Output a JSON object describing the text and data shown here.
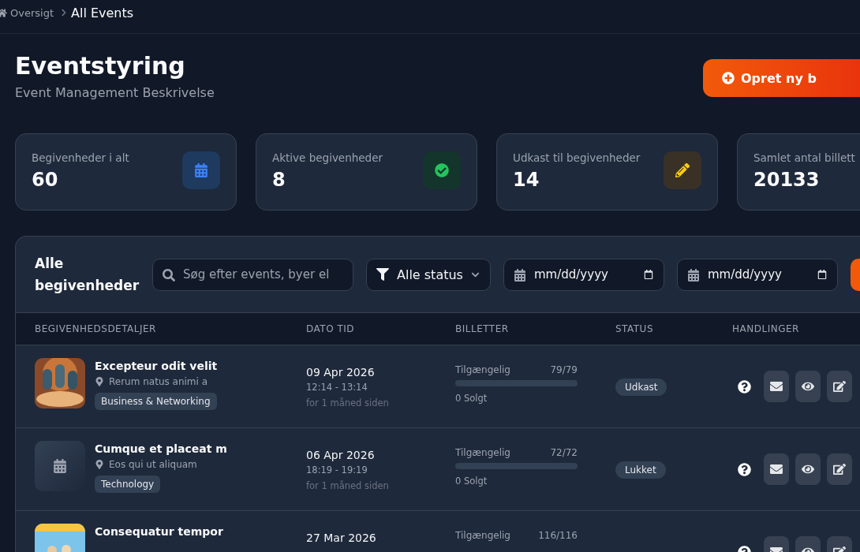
{
  "breadcrumb": [
    {
      "label": "Oversigt",
      "kind": "home"
    },
    {
      "label": "All Events",
      "kind": "current"
    }
  ],
  "header": {
    "title": "Eventstyring",
    "subtitle": "Event Management Beskrivelse",
    "create_button": "Opret ny b"
  },
  "stats": [
    {
      "label": "Begivenheder i alt",
      "value": "60",
      "kind": "calendar"
    },
    {
      "label": "Aktive begivenheder",
      "value": "8",
      "kind": "active"
    },
    {
      "label": "Udkast til begivenheder",
      "value": "14",
      "kind": "draft"
    },
    {
      "label": "Samlet antal billett",
      "value": "20133",
      "kind": "tickets"
    }
  ],
  "panel": {
    "title": "Alle begivenheder",
    "search": {
      "placeholder": "Søg efter events, byer el"
    },
    "status_filter": "Alle status",
    "date_from": {
      "placeholder": "mm/dd/yyyy"
    },
    "date_to": {
      "placeholder": "mm/dd/yyyy"
    }
  },
  "table": {
    "columns": [
      "BEGIVENHEDSDETALJER",
      "DATO TID",
      "BILLETTER",
      "STATUS",
      "HANDLINGER"
    ],
    "rows": [
      {
        "kind": "picture",
        "title": "Excepteur odit velit",
        "location": "Rerum natus animi a",
        "category": "Business & Networking",
        "date": "09 Apr 2026",
        "time": "12:14 - 13:14",
        "relative": "for 1 måned siden",
        "tickets_label": "Tilgængelig",
        "tickets": "79/79",
        "level": 0,
        "sold": "0 Solgt",
        "status": "Udkast"
      },
      {
        "kind": "placeholder",
        "title": "Cumque et placeat m",
        "location": "Eos qui ut aliquam",
        "category": "Technology",
        "date": "06 Apr 2026",
        "time": "18:19 - 19:19",
        "relative": "for 1 måned siden",
        "tickets_label": "Tilgængelig",
        "tickets": "72/72",
        "level": 0,
        "sold": "0 Solgt",
        "status": "Lukket"
      },
      {
        "kind": "picture",
        "title": "Consequatur tempor",
        "date": "27 Mar 2026",
        "tickets_label": "Tilgængelig",
        "tickets": "116/116"
      }
    ]
  }
}
